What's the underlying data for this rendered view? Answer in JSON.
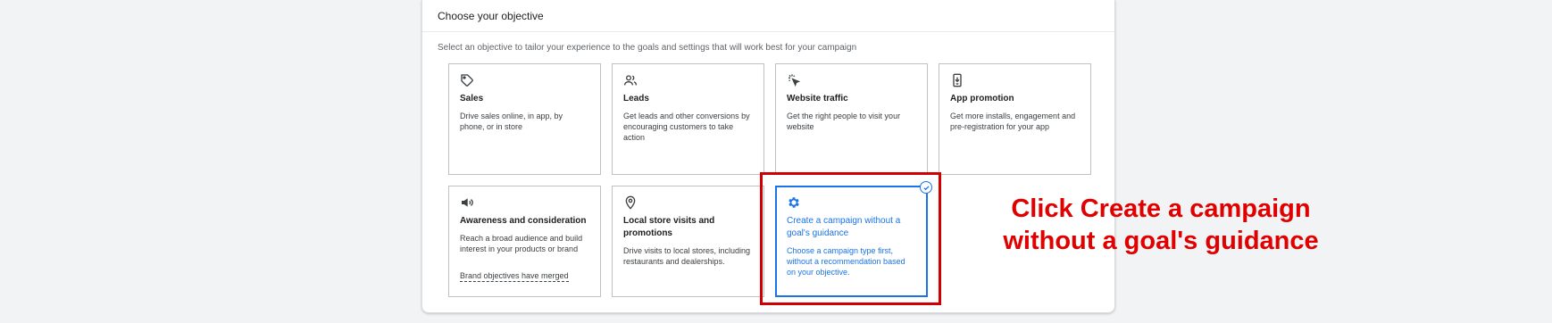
{
  "panel": {
    "title": "Choose your objective",
    "description": "Select an objective to tailor your experience to the goals and settings that will work best for your campaign"
  },
  "objectives": [
    {
      "title": "Sales",
      "description": "Drive sales online, in app, by phone, or in store",
      "icon": "tag-icon"
    },
    {
      "title": "Leads",
      "description": "Get leads and other conversions by encouraging customers to take action",
      "icon": "people-icon"
    },
    {
      "title": "Website traffic",
      "description": "Get the right people to visit your website",
      "icon": "cursor-click-icon"
    },
    {
      "title": "App promotion",
      "description": "Get more installs, engagement and pre-registration for your app",
      "icon": "phone-download-icon"
    },
    {
      "title": "Awareness and consideration",
      "description": "Reach a broad audience and build interest in your products or brand",
      "icon": "megaphone-icon",
      "link": "Brand objectives have merged"
    },
    {
      "title": "Local store visits and promotions",
      "description": "Drive visits to local stores, including restaurants and dealerships.",
      "icon": "location-pin-icon"
    },
    {
      "title": "Create a campaign without a goal's guidance",
      "description": "Choose a campaign type first, without a recommendation based on your objective.",
      "icon": "gear-icon",
      "selected": true
    }
  ],
  "annotation": {
    "text": "Click Create a campaign without a goal's guidance",
    "color": "#e00000"
  },
  "colors": {
    "accent": "#1a73e8",
    "highlight": "#d10000"
  }
}
